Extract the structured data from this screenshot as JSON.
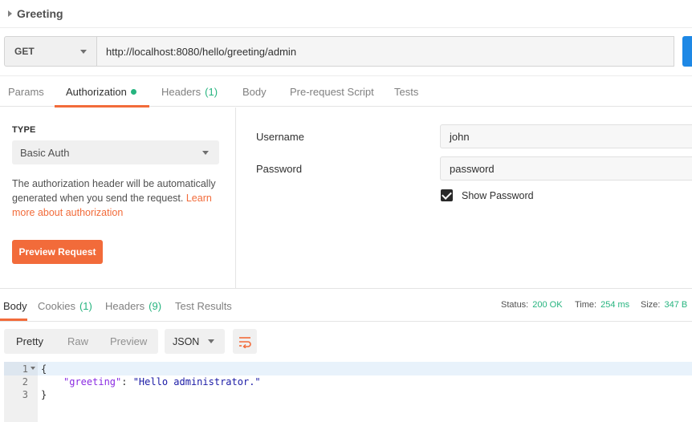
{
  "request_name": "Greeting",
  "method": "GET",
  "url": "http://localhost:8080/hello/greeting/admin",
  "request_tabs": [
    {
      "label": "Params",
      "count": ""
    },
    {
      "label": "Authorization",
      "count": ""
    },
    {
      "label": "Headers",
      "count": "(1)"
    },
    {
      "label": "Body",
      "count": ""
    },
    {
      "label": "Pre-request Script",
      "count": ""
    },
    {
      "label": "Tests",
      "count": ""
    }
  ],
  "auth": {
    "type_label": "TYPE",
    "type_value": "Basic Auth",
    "description": "The authorization header will be automatically generated when you send the request.",
    "learn_more": "Learn more about authorization",
    "preview_button": "Preview Request",
    "username_label": "Username",
    "username_value": "john",
    "password_label": "Password",
    "password_value": "password",
    "show_password_label": "Show Password",
    "show_password_checked": true
  },
  "response_tabs": [
    {
      "label": "Body",
      "count": ""
    },
    {
      "label": "Cookies",
      "count": "(1)"
    },
    {
      "label": "Headers",
      "count": "(9)"
    },
    {
      "label": "Test Results",
      "count": ""
    }
  ],
  "response_stats": {
    "status_label": "Status:",
    "status_value": "200 OK",
    "time_label": "Time:",
    "time_value": "254 ms",
    "size_label": "Size:",
    "size_value": "347 B"
  },
  "view_modes": [
    "Pretty",
    "Raw",
    "Preview"
  ],
  "format": "JSON",
  "code": {
    "line_numbers": [
      "1",
      "2",
      "3"
    ],
    "open_brace": "{",
    "key": "\"greeting\"",
    "colon": ": ",
    "value": "\"Hello administrator.\"",
    "close_brace": "}"
  },
  "colors": {
    "accent": "#f26b3a",
    "success": "#26b47f",
    "send": "#1e88e5"
  }
}
